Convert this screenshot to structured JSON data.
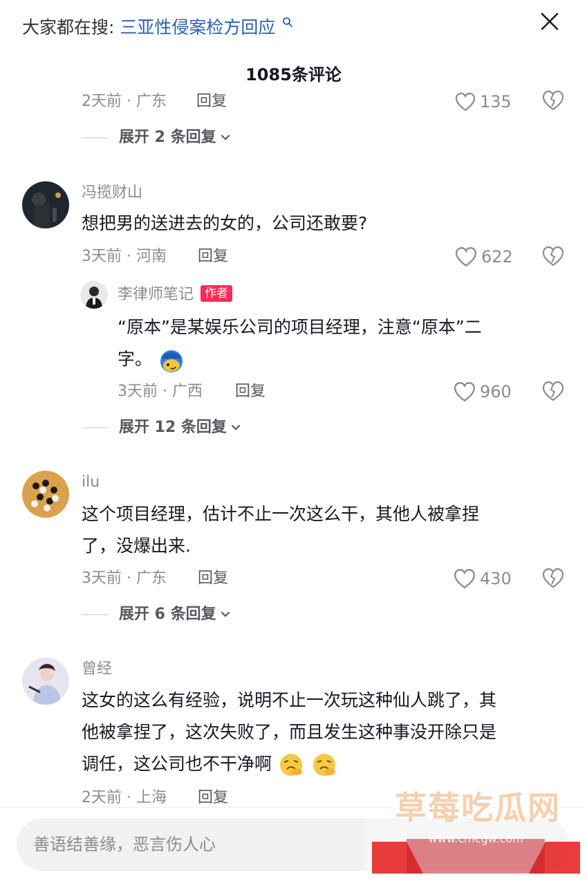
{
  "search_hint": {
    "prefix": "大家都在搜:",
    "query": "三亚性侵案检方回应"
  },
  "comment_count": "1085条评论",
  "partial_top": {
    "meta": "2天前 · 广东",
    "reply": "回复",
    "likes": "135"
  },
  "expand_labels": [
    "展开 2 条回复",
    "展开 12 条回复",
    "展开 6 条回复"
  ],
  "comments": [
    {
      "username": "冯揽财山",
      "text": "想把男的送进去的女的，公司还敢要?",
      "meta": "3天前 · 河南",
      "reply": "回复",
      "likes": "622",
      "reply_item": {
        "username": "李律师笔记",
        "badge": "作者",
        "text_line1": "“原本”是某娱乐公司的项目经理，注意“原本”二",
        "text_line2": "字。",
        "meta": "3天前 · 广西",
        "reply": "回复",
        "likes": "960"
      }
    },
    {
      "username": "ilu",
      "text_line1": "这个项目经理，估计不止一次这么干，其他人被拿捏",
      "text_line2": "了，没爆出来.",
      "meta": "3天前 · 广东",
      "reply": "回复",
      "likes": "430"
    },
    {
      "username": "曾经",
      "text_line1": "这女的这么有经验，说明不止一次玩这种仙人跳了，其",
      "text_line2": "他被拿捏了，这次失败了，而且发生这种事没开除只是",
      "text_line3": "调任，这公司也不干净啊",
      "meta": "2天前 · 上海",
      "reply": "回复"
    }
  ],
  "input": {
    "placeholder": "善语结善缘，恶言伤人心"
  },
  "watermark": {
    "title": "草莓吃瓜网",
    "url": "www.cmcgw.com"
  },
  "colors": {
    "accent": "#fe2c55",
    "link": "#2a5fb3",
    "muted": "#8a8b91"
  },
  "icons": [
    "search-icon",
    "close-icon",
    "heart-icon",
    "dislike-heart-icon",
    "chevron-down-icon",
    "emoji-icon"
  ]
}
